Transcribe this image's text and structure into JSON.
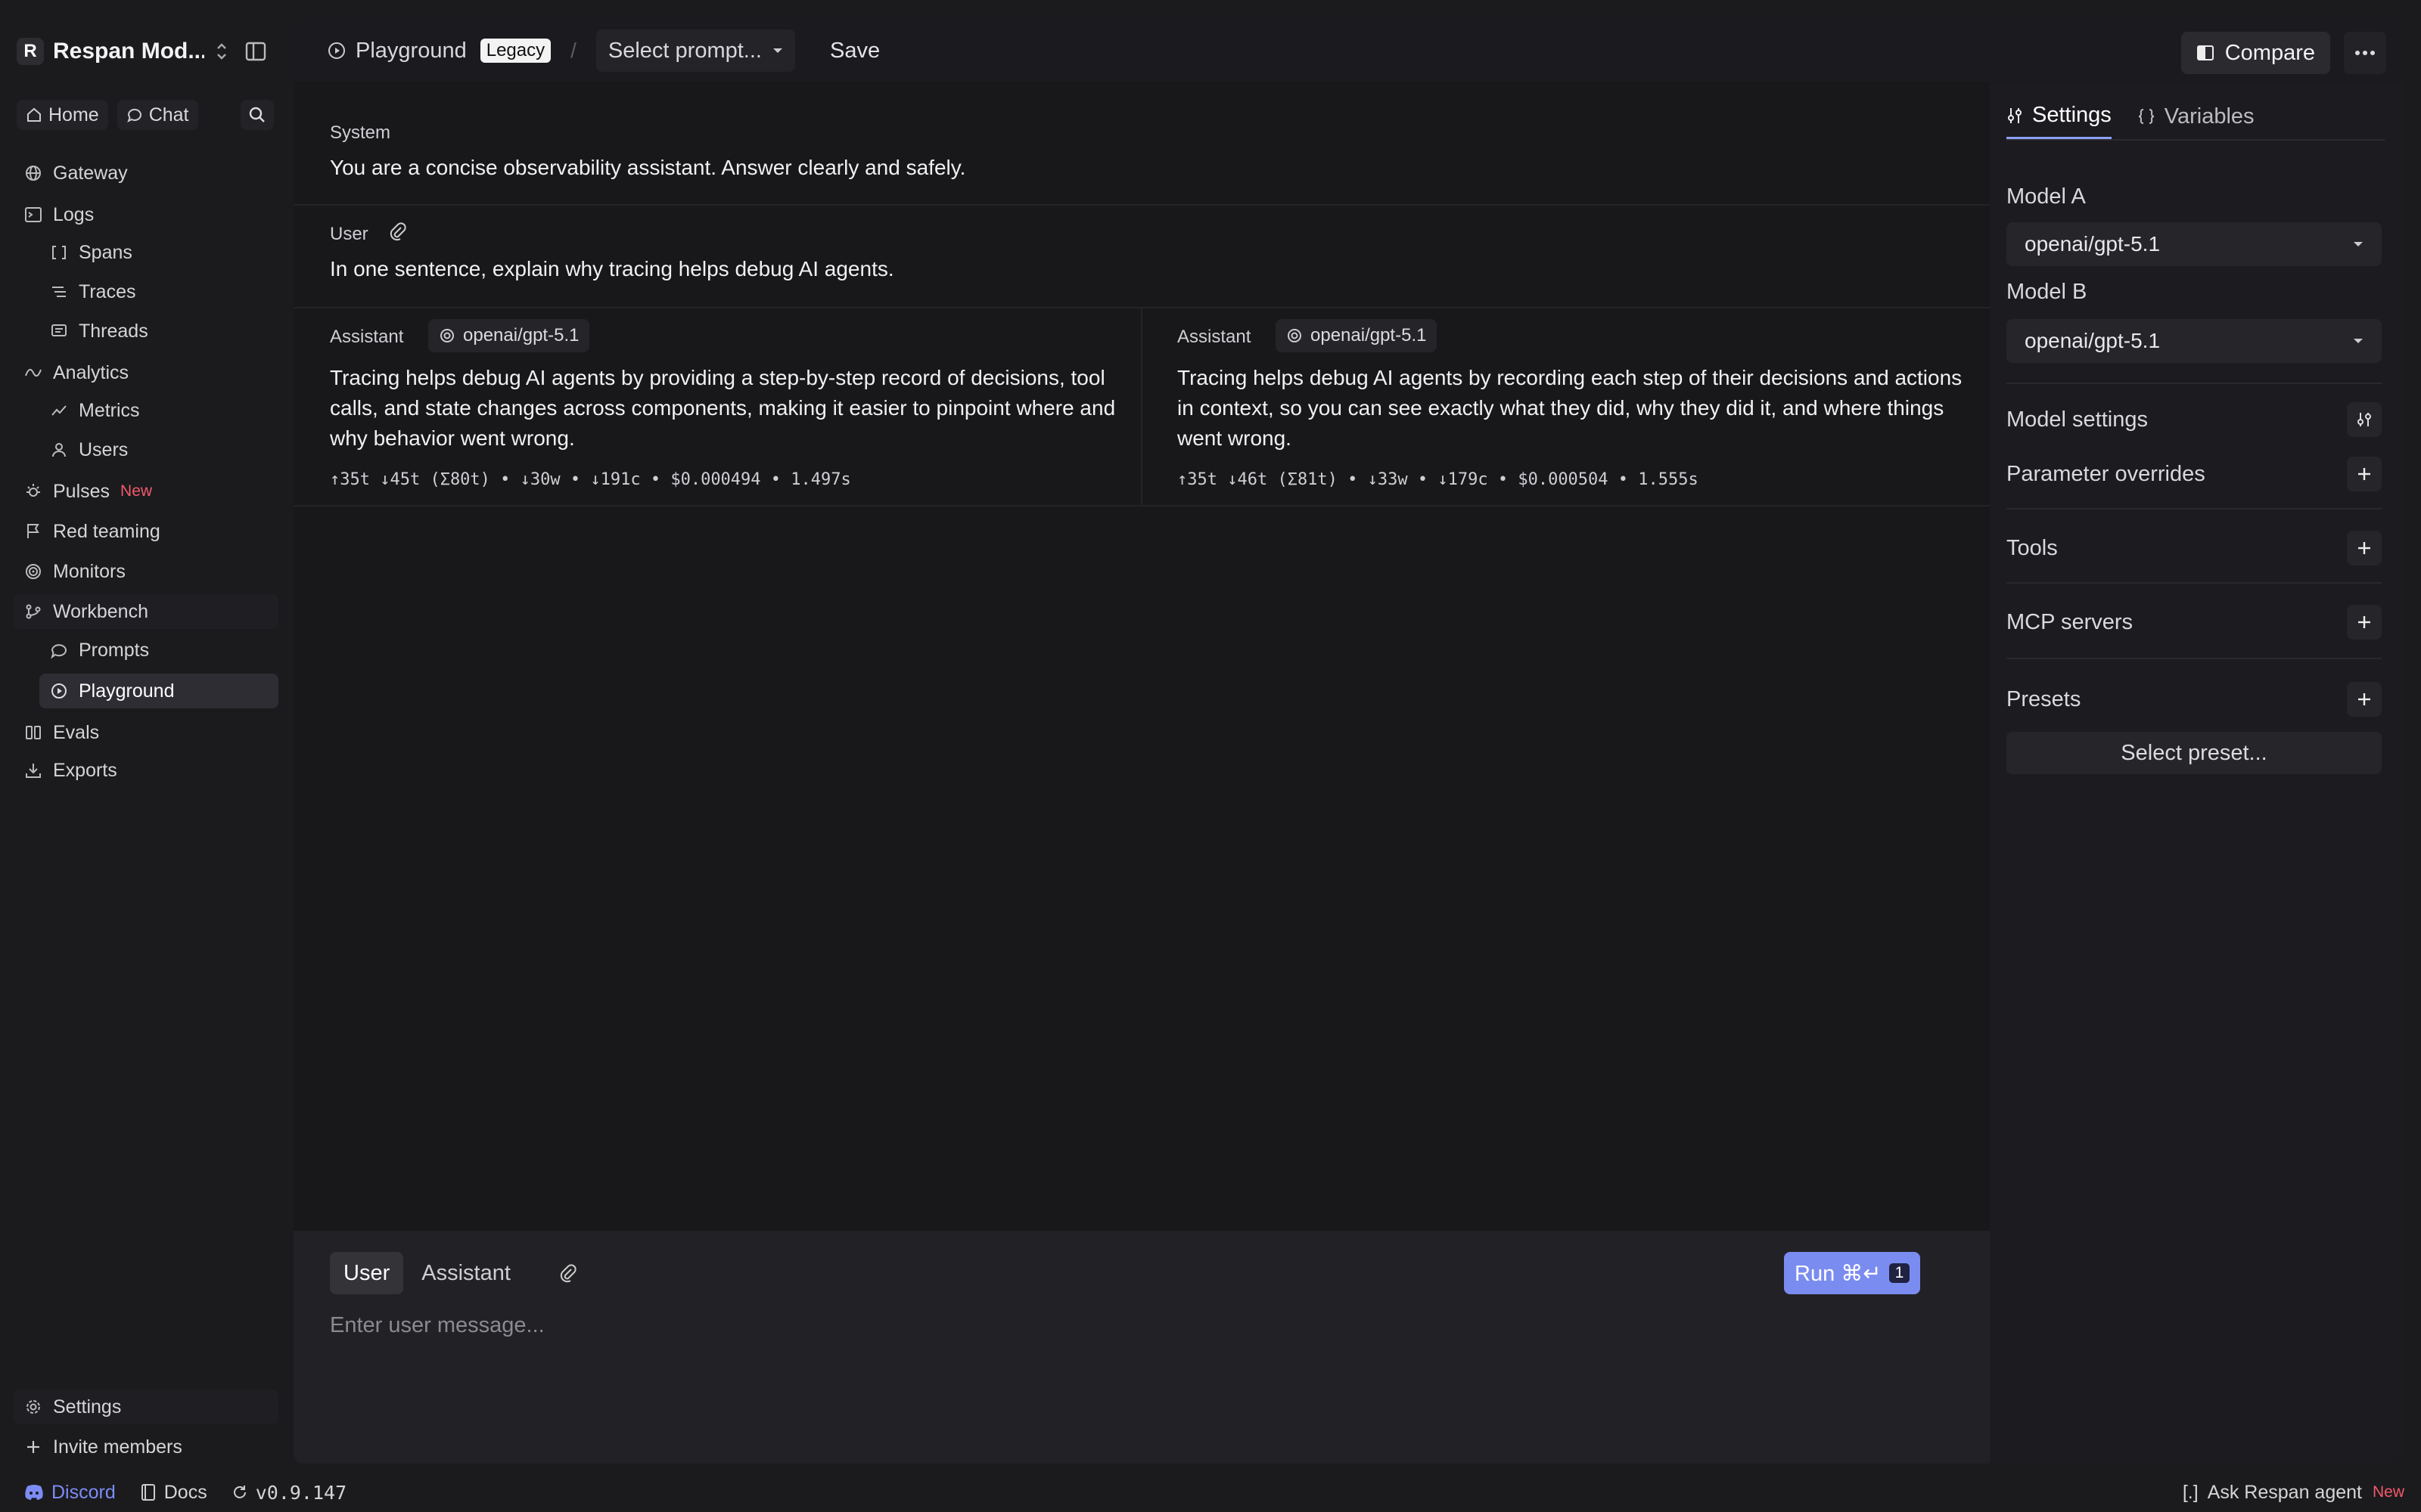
{
  "workspace": {
    "initial": "R",
    "name": "Respan Mod..."
  },
  "quick": {
    "home": "Home",
    "chat": "Chat"
  },
  "nav": {
    "gateway": "Gateway",
    "logs": "Logs",
    "spans": "Spans",
    "traces": "Traces",
    "threads": "Threads",
    "analytics": "Analytics",
    "metrics": "Metrics",
    "users": "Users",
    "pulses": "Pulses",
    "pulses_badge": "New",
    "red_teaming": "Red teaming",
    "monitors": "Monitors",
    "workbench": "Workbench",
    "prompts": "Prompts",
    "playground": "Playground",
    "evals": "Evals",
    "exports": "Exports",
    "settings": "Settings",
    "invite": "Invite members"
  },
  "footer": {
    "discord": "Discord",
    "docs": "Docs",
    "version": "v0.9.147",
    "agent_prefix": "[.]",
    "agent": "Ask Respan agent",
    "agent_badge": "New"
  },
  "topbar": {
    "title": "Playground",
    "legacy": "Legacy",
    "separator": "/",
    "prompt_select": "Select prompt...",
    "save": "Save",
    "compare": "Compare"
  },
  "chat": {
    "system_label": "System",
    "system_text": "You are a concise observability assistant. Answer clearly and safely.",
    "user_label": "User",
    "user_text": "In one sentence, explain why tracing helps debug AI agents.",
    "responses": [
      {
        "label": "Assistant",
        "model": "openai/gpt-5.1",
        "text": "Tracing helps debug AI agents by providing a step-by-step record of decisions, tool calls, and state changes across components, making it easier to pinpoint where and why behavior went wrong.",
        "metrics": "↑35t ↓45t (Σ80t) • ↓30w • ↓191c • $0.000494 • 1.497s"
      },
      {
        "label": "Assistant",
        "model": "openai/gpt-5.1",
        "text": "Tracing helps debug AI agents by recording each step of their decisions and actions in context, so you can see exactly what they did, why they did it, and where things went wrong.",
        "metrics": "↑35t ↓46t (Σ81t) • ↓33w • ↓179c • $0.000504 • 1.555s"
      }
    ]
  },
  "composer": {
    "tab_user": "User",
    "tab_assistant": "Assistant",
    "run": "Run ⌘↵",
    "run_count": "1",
    "placeholder": "Enter user message..."
  },
  "settings": {
    "tab_settings": "Settings",
    "tab_variables": "Variables",
    "model_a_label": "Model A",
    "model_a": "openai/gpt-5.1",
    "model_b_label": "Model B",
    "model_b": "openai/gpt-5.1",
    "model_settings": "Model settings",
    "parameter_overrides": "Parameter overrides",
    "tools": "Tools",
    "mcp_servers": "MCP servers",
    "presets": "Presets",
    "select_preset": "Select preset..."
  },
  "colors": {
    "accent": "#7b8cf0",
    "badge_new": "#f25a6a",
    "discord": "#7d8cf5",
    "background": "#1b1b1e"
  },
  "icons": [
    "home-icon",
    "chat-icon",
    "search-icon",
    "globe-icon",
    "terminal-icon",
    "brackets-icon",
    "traces-icon",
    "threads-icon",
    "analytics-icon",
    "metrics-icon",
    "user-icon",
    "pulse-icon",
    "flag-icon",
    "monitor-icon",
    "workbench-icon",
    "chat-bubble-icon",
    "play-circle-icon",
    "columns-icon",
    "download-icon",
    "gear-icon",
    "plus-icon",
    "discord-icon",
    "book-icon",
    "refresh-icon",
    "paperclip-icon",
    "openai-icon",
    "compare-icon",
    "more-icon",
    "sliders-icon",
    "braces-icon",
    "caret-down-icon",
    "sidebar-toggle-icon",
    "chevron-updown-icon"
  ]
}
